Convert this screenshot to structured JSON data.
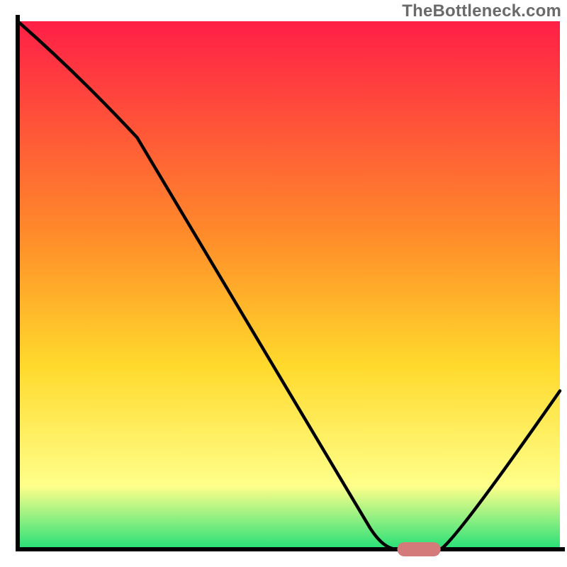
{
  "watermark_text": "TheBottleneck.com",
  "colors": {
    "gradient_top": "#ff1f47",
    "gradient_mid1": "#ff8a2a",
    "gradient_mid2": "#ffd92b",
    "gradient_low": "#ffff8a",
    "gradient_bottom": "#25e078",
    "axis": "#000000",
    "curve": "#000000",
    "marker_fill": "#d47a7a"
  },
  "chart_data": {
    "type": "line",
    "title": "",
    "xlabel": "",
    "ylabel": "",
    "xlim": [
      0,
      100
    ],
    "ylim": [
      0,
      100
    ],
    "x": [
      0,
      22,
      65,
      70,
      78,
      100
    ],
    "values": [
      100,
      78,
      4,
      0,
      0,
      30
    ],
    "marker": {
      "x_start": 70,
      "x_end": 78,
      "y": 0
    },
    "background_gradient_note": "red→orange→yellow→green vertical gradient representing severity"
  }
}
